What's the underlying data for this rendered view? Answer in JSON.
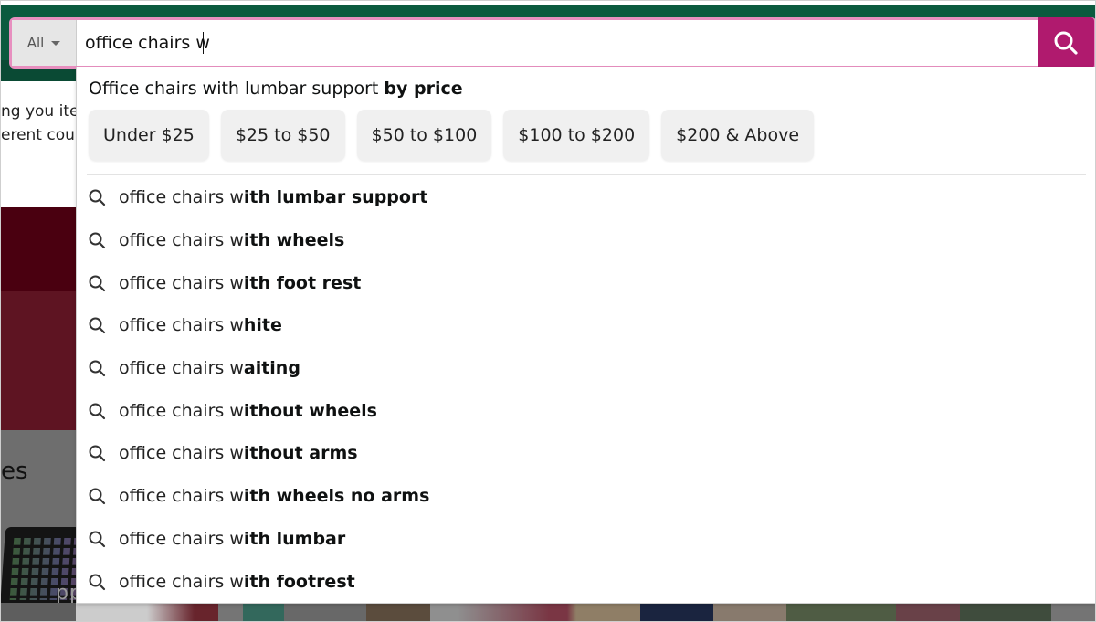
{
  "search": {
    "scope_label": "All",
    "query": "office chairs w",
    "submit_icon": "search-icon"
  },
  "colors": {
    "header": "#0b5a3e",
    "search_button": "#b01a6e",
    "search_border": "#e78fbf"
  },
  "background_page": {
    "line1": "ng you iter",
    "line2": "erent cour",
    "heading_fragment": "es",
    "watermark": "pprofty"
  },
  "price_filter": {
    "title_prefix": "Office chairs with lumbar support ",
    "title_bold": "by price",
    "chips": [
      {
        "label": "Under $25"
      },
      {
        "label": "$25 to $50"
      },
      {
        "label": "$50 to $100"
      },
      {
        "label": "$100 to $200"
      },
      {
        "label": "$200 & Above"
      }
    ]
  },
  "suggestions": [
    {
      "typed": "office chairs w",
      "completion": "ith lumbar support",
      "icon": "search-icon"
    },
    {
      "typed": "office chairs w",
      "completion": "ith wheels",
      "icon": "search-icon"
    },
    {
      "typed": "office chairs w",
      "completion": "ith foot rest",
      "icon": "search-icon"
    },
    {
      "typed": "office chairs w",
      "completion": "hite",
      "icon": "search-icon"
    },
    {
      "typed": "office chairs w",
      "completion": "aiting",
      "icon": "search-icon"
    },
    {
      "typed": "office chairs w",
      "completion": "ithout wheels",
      "icon": "search-icon"
    },
    {
      "typed": "office chairs w",
      "completion": "ithout arms",
      "icon": "search-icon"
    },
    {
      "typed": "office chairs w",
      "completion": "ith wheels no arms",
      "icon": "search-icon"
    },
    {
      "typed": "office chairs w",
      "completion": "ith lumbar",
      "icon": "search-icon"
    },
    {
      "typed": "office chairs w",
      "completion": "ith footrest",
      "icon": "search-icon"
    }
  ]
}
